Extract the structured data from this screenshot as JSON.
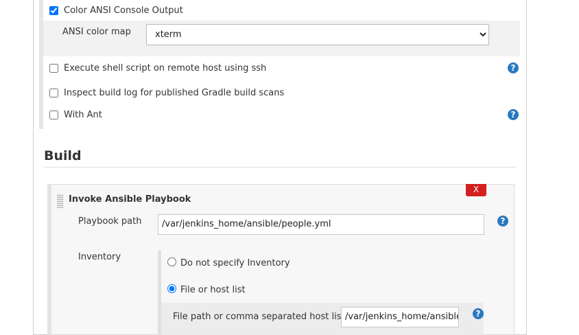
{
  "wrappers": {
    "color_ansi": {
      "label": "Color ANSI Console Output",
      "checked": true
    },
    "ansi_map": {
      "label": "ANSI color map",
      "selected": "xterm"
    },
    "remote_shell": {
      "label": "Execute shell script on remote host using ssh",
      "checked": false
    },
    "gradle_scans": {
      "label": "Inspect build log for published Gradle build scans",
      "checked": false
    },
    "with_ant": {
      "label": "With Ant",
      "checked": false
    }
  },
  "build": {
    "section_title": "Build",
    "step_title": "Invoke Ansible Playbook",
    "close_label": "X",
    "playbook_label": "Playbook path",
    "playbook_value": "/var/jenkins_home/ansible/people.yml",
    "inventory_label": "Inventory",
    "inventory_options": [
      "Do not specify Inventory",
      "File or host list"
    ],
    "inventory_selected": 1,
    "hostlist_label": "File path or comma separated host list",
    "hostlist_value": "/var/jenkins_home/ansible"
  },
  "help_glyph": "?",
  "colors": {
    "help": "#2a79c0",
    "close": "#d31f1f"
  }
}
